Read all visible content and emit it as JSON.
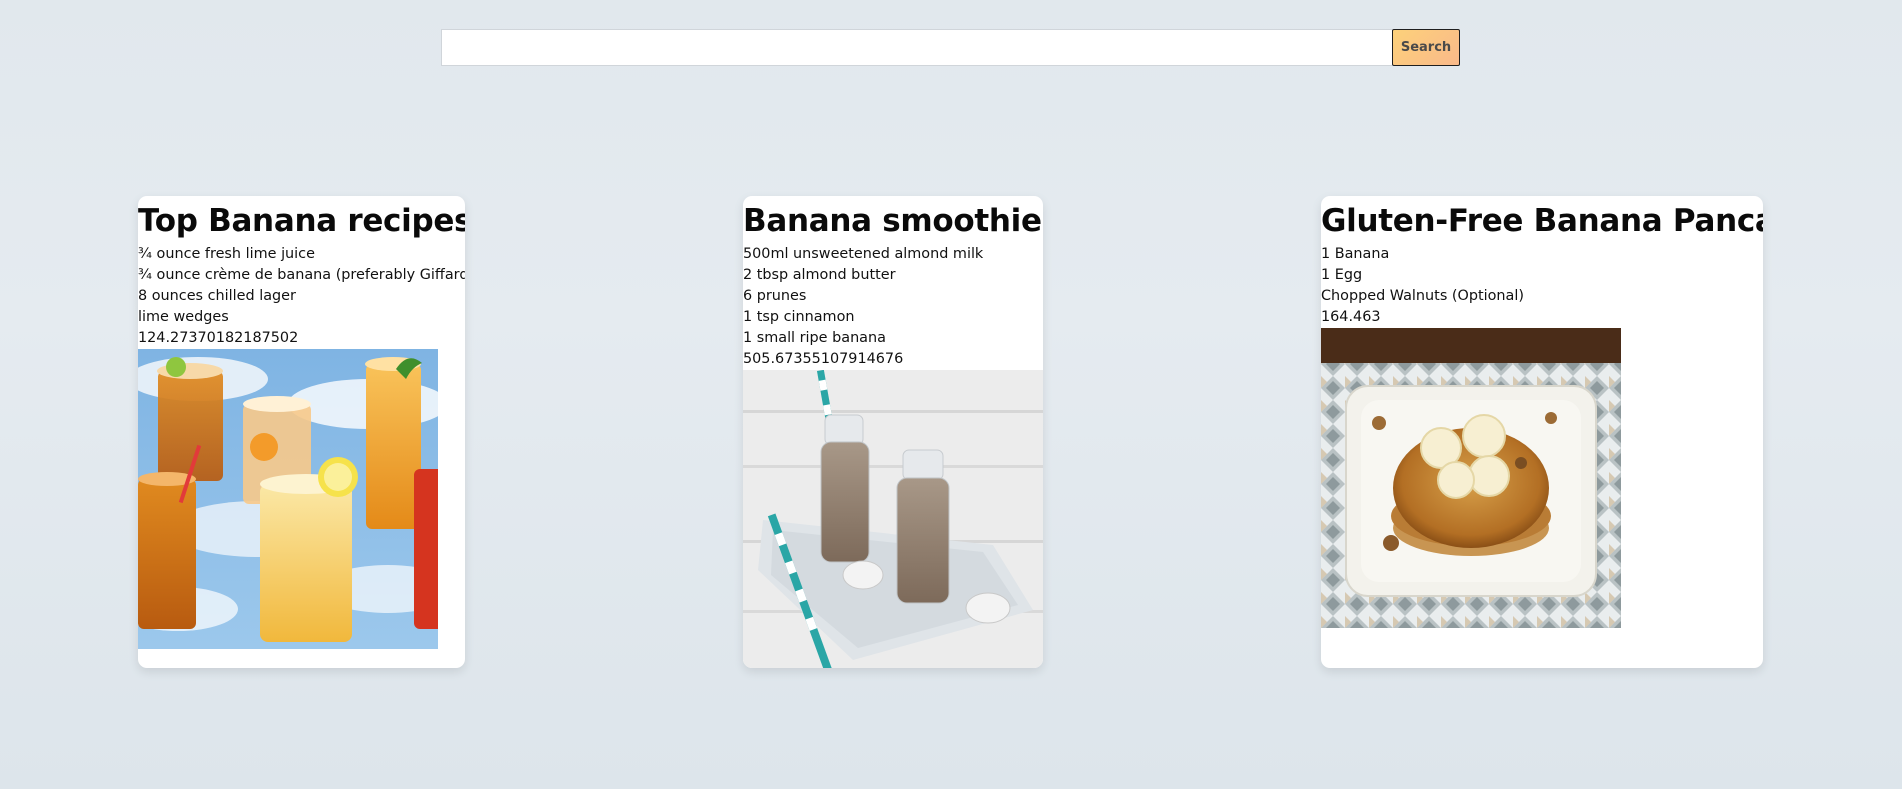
{
  "search": {
    "placeholder": "",
    "value": "",
    "button_label": "Search"
  },
  "cards": [
    {
      "title": "Top Banana recipes",
      "ingredients": [
        "¾ ounce fresh lime juice",
        "¾ ounce crème de banana (preferably Giffard)",
        "8 ounces chilled lager",
        "lime wedges"
      ],
      "number": "124.27370182187502",
      "image": "iced-drinks-photo"
    },
    {
      "title": "Banana smoothie",
      "ingredients": [
        "500ml unsweetened almond milk",
        "2 tbsp almond butter",
        "6 prunes",
        "1 tsp cinnamon",
        "1 small ripe banana"
      ],
      "number": "505.67355107914676",
      "image": "smoothie-bottles-photo"
    },
    {
      "title": "Gluten-Free Banana Pancakes",
      "ingredients": [
        "1 Banana",
        "1 Egg",
        "Chopped Walnuts (Optional)"
      ],
      "number": "164.463",
      "image": "pancakes-plate-photo"
    }
  ],
  "colors": {
    "background": "#e1e8ed",
    "card": "#ffffff",
    "button_gradient_start": "#fdd17a",
    "button_gradient_end": "#f9b98a",
    "button_border": "#1f1f1f"
  }
}
